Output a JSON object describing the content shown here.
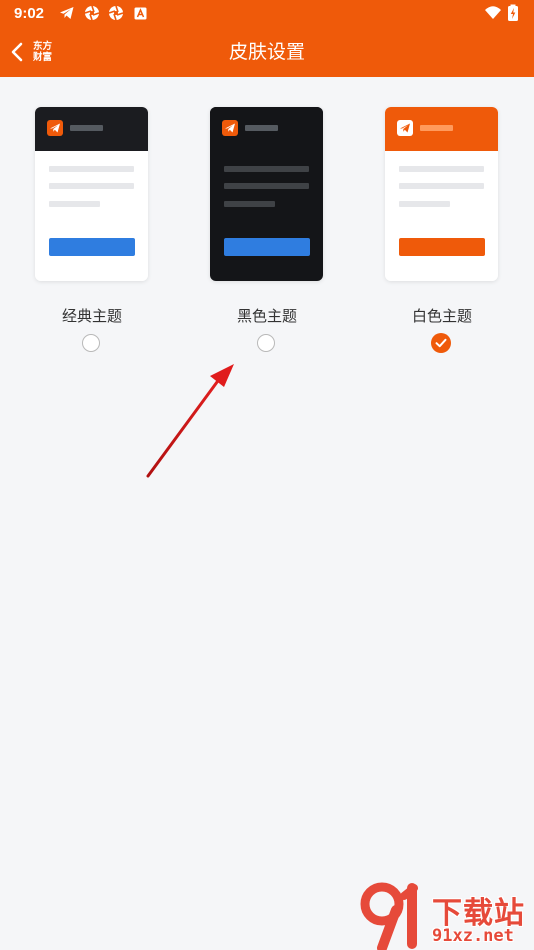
{
  "status_bar": {
    "time": "9:02",
    "left_icons": [
      "telegram-icon",
      "aperture-icon",
      "aperture-icon",
      "font-a-icon"
    ],
    "right_icons": [
      "wifi-icon",
      "battery-charging-icon"
    ]
  },
  "nav": {
    "back_icon": "chevron-left-icon",
    "brand_line1": "东方",
    "brand_line2": "财富",
    "title": "皮肤设置"
  },
  "themes": [
    {
      "label": "经典主题",
      "checked": false,
      "colors": {
        "head": "#1b1c20",
        "body": "#ffffff",
        "line": "#e6e7ea",
        "button": "#2f7de0",
        "headbar": "#555a60"
      }
    },
    {
      "label": "黑色主题",
      "checked": false,
      "colors": {
        "head": "#141518",
        "body": "#141518",
        "line": "#3f4246",
        "button": "#2f7de0",
        "headbar": "#555a60"
      }
    },
    {
      "label": "白色主题",
      "checked": true,
      "colors": {
        "head": "#ef5a0a",
        "body": "#ffffff",
        "line": "#e6e7ea",
        "button": "#ef5a0a",
        "headbar": "#ff9a5c"
      }
    }
  ],
  "colors": {
    "brand": "#ef5a0a",
    "background": "#f5f6f8",
    "annotation_arrow": "#d91c1c"
  },
  "watermark": {
    "title": "下载站",
    "url": "91xz.net"
  }
}
